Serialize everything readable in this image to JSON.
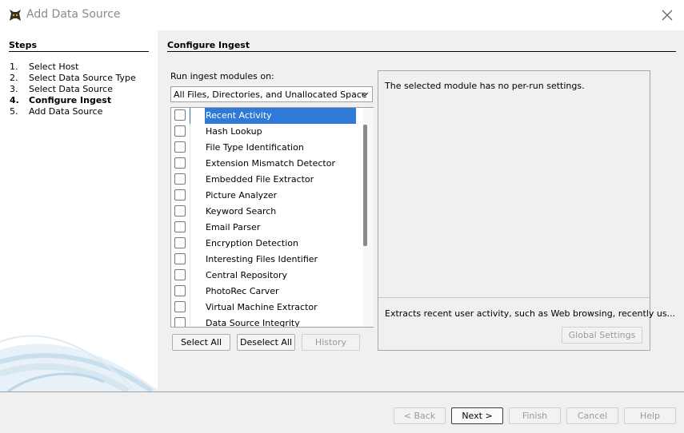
{
  "window": {
    "title": "Add Data Source",
    "icon": "autopsy-dog-icon"
  },
  "steps": {
    "heading": "Steps",
    "items": [
      {
        "num": "1.",
        "label": "Select Host"
      },
      {
        "num": "2.",
        "label": "Select Data Source Type"
      },
      {
        "num": "3.",
        "label": "Select Data Source"
      },
      {
        "num": "4.",
        "label": "Configure Ingest"
      },
      {
        "num": "5.",
        "label": "Add Data Source"
      }
    ],
    "current_index": 3
  },
  "ingest": {
    "heading": "Configure Ingest",
    "run_label": "Run ingest modules on:",
    "run_on_value": "All Files, Directories, and Unallocated Space",
    "modules": [
      "Recent Activity",
      "Hash Lookup",
      "File Type Identification",
      "Extension Mismatch Detector",
      "Embedded File Extractor",
      "Picture Analyzer",
      "Keyword Search",
      "Email Parser",
      "Encryption Detection",
      "Interesting Files Identifier",
      "Central Repository",
      "PhotoRec Carver",
      "Virtual Machine Extractor",
      "Data Source Integrity"
    ],
    "selected_index": 0,
    "select_all": "Select All",
    "deselect_all": "Deselect All",
    "history": "History",
    "settings_message": "The selected module has no per-run settings.",
    "module_description": "Extracts recent user activity, such as Web browsing, recently us...",
    "global_settings": "Global Settings"
  },
  "footer": {
    "back": "< Back",
    "next": "Next >",
    "finish": "Finish",
    "cancel": "Cancel",
    "help": "Help"
  },
  "colors": {
    "selection": "#2f7ad6",
    "window_bg": "#f0f0f0",
    "swoosh": "#cfe2ef"
  }
}
